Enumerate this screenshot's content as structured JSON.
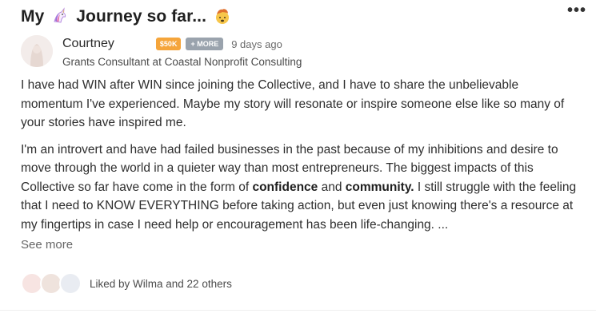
{
  "post": {
    "title_start": "My",
    "title_middle": "Journey so far...",
    "title_icon_1": "unicorn-emoji",
    "title_icon_2": "exploding-head-emoji",
    "menu_label": "•••"
  },
  "author": {
    "name": "Courtney",
    "badge": "$50K",
    "more_badge": "+ MORE",
    "time": "9 days ago",
    "title": "Grants Consultant at Coastal Nonprofit Consulting"
  },
  "body": {
    "p1": "I have had WIN after WIN since joining the Collective, and I have to share the unbelievable momentum I've experienced. Maybe my story will resonate or inspire someone else like so many of your stories have inspired me.",
    "p2_a": "I'm an introvert and have had failed businesses in the past because of my inhibitions and desire to move through the world in a quieter way than most entrepreneurs. The biggest impacts of this Collective so far have come in the form of ",
    "p2_bold1": "confidence",
    "p2_b": " and ",
    "p2_bold2": "community.",
    "p2_c": " I still struggle with the feeling that I need to KNOW EVERYTHING before taking action, but even just knowing there's a resource at my fingertips in case I need help or encouragement has been life-changing. ...",
    "see_more": "See more"
  },
  "likes": {
    "text": "Liked by Wilma and 22 others"
  },
  "colors": {
    "badge": "#f5a53b",
    "more_badge": "#9aa3ad"
  }
}
